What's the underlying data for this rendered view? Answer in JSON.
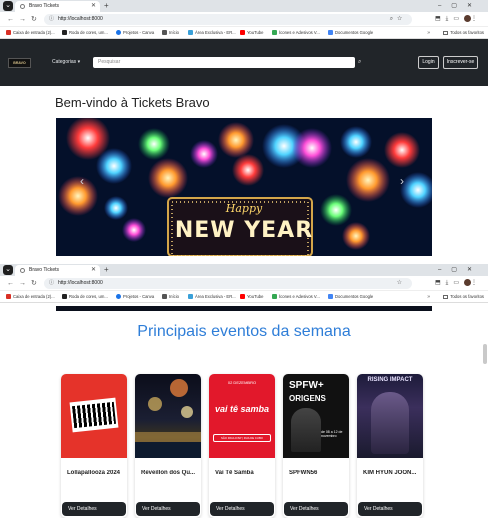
{
  "browser": {
    "tab_title": "Bravo Tickets",
    "url": "http://localhost:8000",
    "bookmarks": [
      "Caixa de entrada (2)...",
      "Roda de cores, um...",
      "Projetos - Canva",
      "Início",
      "Área Exclusiva - ER...",
      "YouTube",
      "Ícones e Adesivos V...",
      "Documentos Google"
    ],
    "all_bookmarks": "Todos os favoritos"
  },
  "site": {
    "logo": "BRAVO",
    "categories_label": "Categorias ▾",
    "search_placeholder": "Pesquisar",
    "login_label": "Login",
    "signup_label": "Inscrever-se",
    "welcome": "Bem-vindo à Tickets Bravo",
    "banner_text": {
      "line1": "Happy",
      "line2": "NEW YEAR"
    }
  },
  "section": {
    "title": "Principais eventos da semana",
    "details_label": "Ver Detalhes"
  },
  "events": [
    {
      "title": "Lollapallooza 2024",
      "poster": "lollapalooza"
    },
    {
      "title": "Reveillon dos Qu...",
      "poster": "reveillon"
    },
    {
      "title": "Vai Tê Samba",
      "poster": "samba",
      "poster_text": [
        "02 DEZEMBRO",
        "vai tê samba",
        "SÃO PAULO/SP | RUA DE CUBO"
      ]
    },
    {
      "title": "SPFWN56",
      "poster": "spfw",
      "poster_text": [
        "SPFW+",
        "ORIGENS",
        "de 08 a 12 de novembro"
      ]
    },
    {
      "title": "KIM HYUN JOON...",
      "poster": "kim",
      "poster_text": [
        "RISING IMPACT"
      ]
    }
  ],
  "colors": {
    "nav_bg": "#212529",
    "title_blue": "#2f7ed8"
  }
}
